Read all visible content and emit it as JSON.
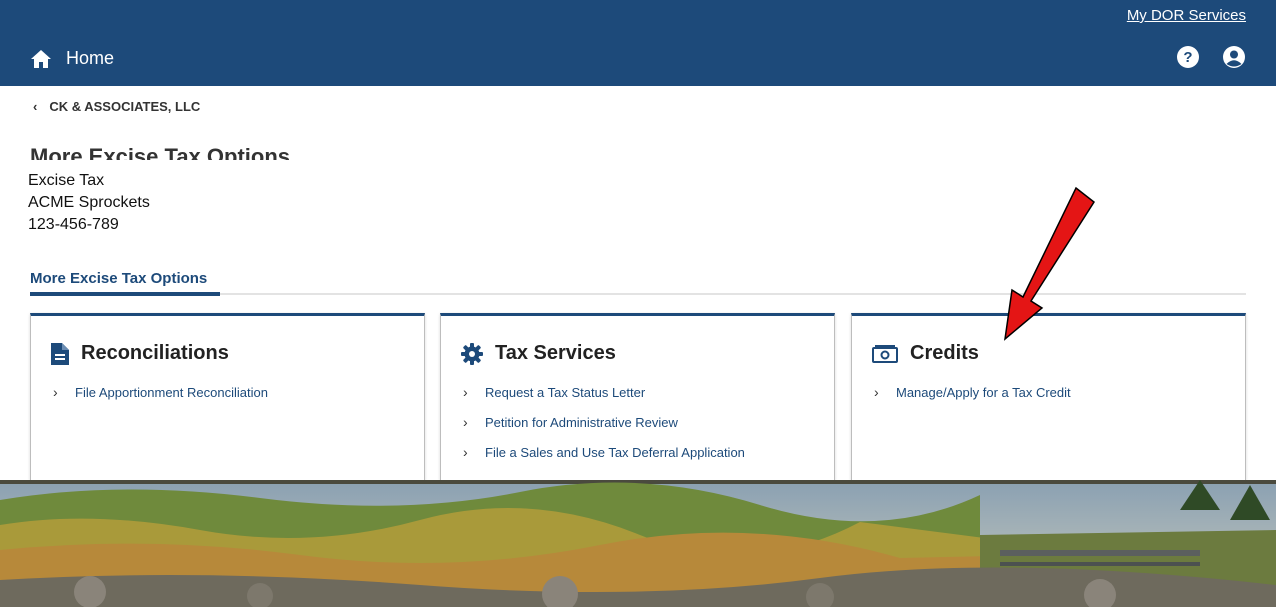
{
  "header": {
    "services_link": "My DOR Services",
    "home_label": "Home"
  },
  "breadcrumb": {
    "label": "CK & ASSOCIATES, LLC"
  },
  "page": {
    "title_cut": "More Excise Tax Options"
  },
  "account": {
    "type": "Excise Tax",
    "name": "ACME Sprockets",
    "number": "123-456-789"
  },
  "tabs": [
    {
      "label": "More Excise Tax Options"
    }
  ],
  "cards": [
    {
      "title": "Reconciliations",
      "icon": "document-icon",
      "links": [
        "File Apportionment Reconciliation"
      ]
    },
    {
      "title": "Tax Services",
      "icon": "gear-icon",
      "links": [
        "Request a Tax Status Letter",
        "Petition for Administrative Review",
        "File a Sales and Use Tax Deferral Application"
      ]
    },
    {
      "title": "Credits",
      "icon": "money-icon",
      "links": [
        "Manage/Apply for a Tax Credit"
      ]
    }
  ],
  "colors": {
    "brand": "#1d4a7a",
    "annotation_arrow": "#e41515"
  }
}
